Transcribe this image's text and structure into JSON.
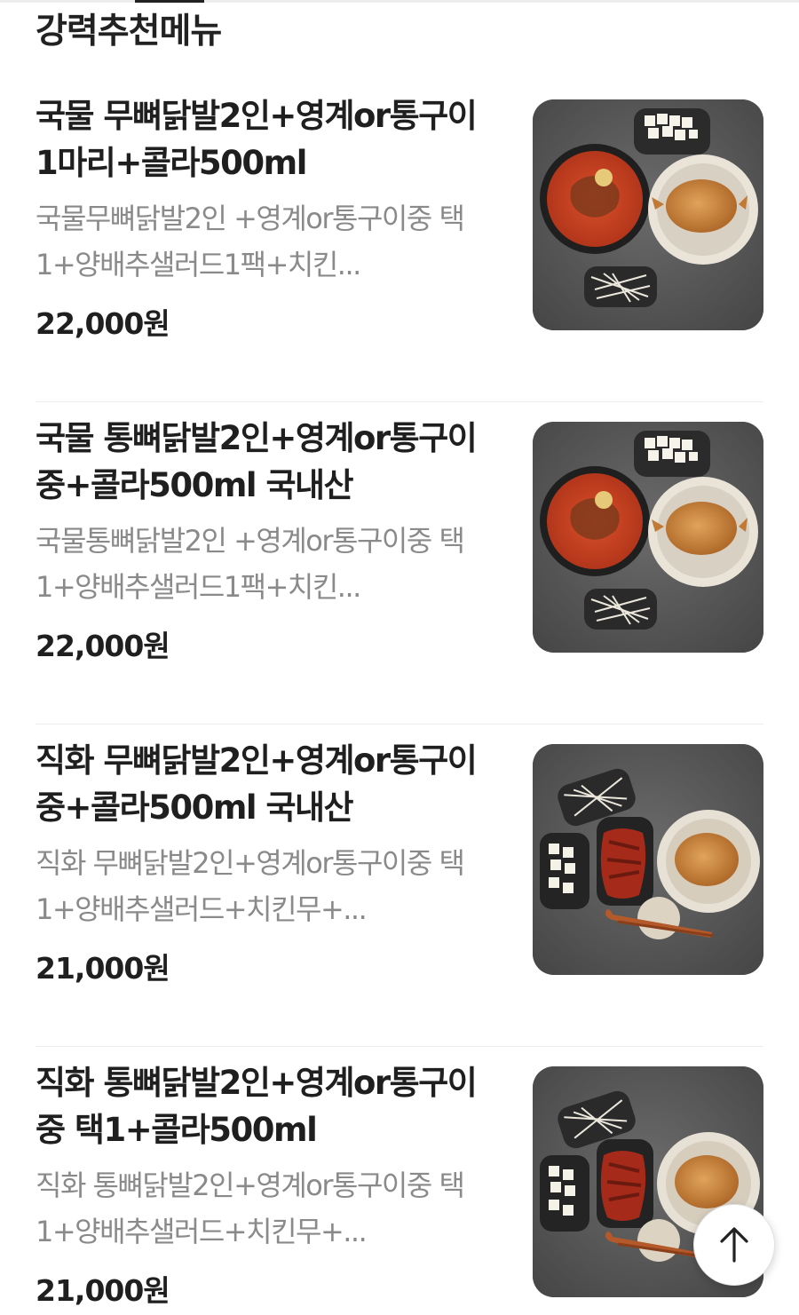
{
  "section": {
    "title": "강력추천메뉴"
  },
  "menu_items": [
    {
      "name": "국물 무뼈닭발2인+영계or통구이1마리+콜라500ml",
      "description": "국물무뼈닭발2인 +영계or통구이중 택1+양배추샐러드1팩+치킨...",
      "price": "22,000원",
      "image": "soup-chicken-feet-set-photo"
    },
    {
      "name": "국물 통뼈닭발2인+영계or통구이중+콜라500ml 국내산",
      "description": "국물통뼈닭발2인 +영계or통구이중 택1+양배추샐러드1팩+치킨...",
      "price": "22,000원",
      "image": "soup-chicken-feet-set-photo"
    },
    {
      "name": "직화 무뼈닭발2인+영계or통구이중+콜라500ml 국내산",
      "description": "직화 무뼈닭발2인+영계or통구이중 택1+양배추샐러드+치킨무+...",
      "price": "21,000원",
      "image": "grilled-chicken-feet-set-photo"
    },
    {
      "name": "직화 통뼈닭발2인+영계or통구이중 택1+콜라500ml",
      "description": "직화 통뼈닭발2인+영계or통구이중 택1+양배추샐러드+치킨무+...",
      "price": "21,000원",
      "image": "grilled-chicken-feet-set-photo"
    }
  ],
  "scroll_top_button": {
    "icon": "arrow-up-icon"
  },
  "colors": {
    "text_primary": "#1f1f1f",
    "text_secondary": "#8a8a8a",
    "divider": "#ececec",
    "photo_background": "#5c5c5c"
  }
}
